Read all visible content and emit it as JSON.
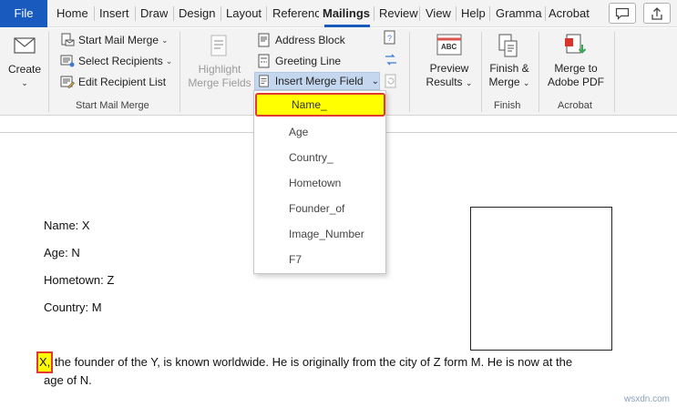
{
  "tabs": {
    "file": "File",
    "home": "Home",
    "insert": "Insert",
    "draw": "Draw",
    "design": "Design",
    "layout": "Layout",
    "references": "Referenc",
    "mailings": "Mailings",
    "review": "Review",
    "view": "View",
    "help": "Help",
    "grammarly": "Gramma",
    "acrobat": "Acrobat"
  },
  "ribbon": {
    "create": {
      "label": "Create"
    },
    "start_mail_merge": {
      "start": "Start Mail Merge",
      "select": "Select Recipients",
      "edit": "Edit Recipient List",
      "group": "Start Mail Merge"
    },
    "highlight": {
      "line1": "Highlight",
      "line2": "Merge Fields"
    },
    "write_insert": {
      "address": "Address Block",
      "greeting": "Greeting Line",
      "insert_field": "Insert Merge Field"
    },
    "preview": {
      "line1": "Preview",
      "line2": "Results"
    },
    "finish": {
      "line1": "Finish &",
      "line2": "Merge",
      "group": "Finish"
    },
    "acrobat": {
      "line1": "Merge to",
      "line2": "Adobe PDF",
      "group": "Acrobat"
    }
  },
  "merge_fields": [
    "Name_",
    "Age",
    "Country_",
    "Hometown",
    "Founder_of",
    "Image_Number",
    "F7"
  ],
  "document": {
    "name": "Name: X",
    "age": "Age: N",
    "hometown": "Hometown: Z",
    "country": "Country: M",
    "para_x": "X,",
    "para_rest_line1": " the founder of the Y, is known worldwide. He is originally from the city of Z form M. He is now at the",
    "para_line2": "age of N."
  },
  "watermark": "wsxdn.com",
  "colors": {
    "file_tab": "#185abd",
    "highlight": "#ffff00",
    "outline": "#e23a2e",
    "insert_field_bg": "#c5d7ef"
  }
}
